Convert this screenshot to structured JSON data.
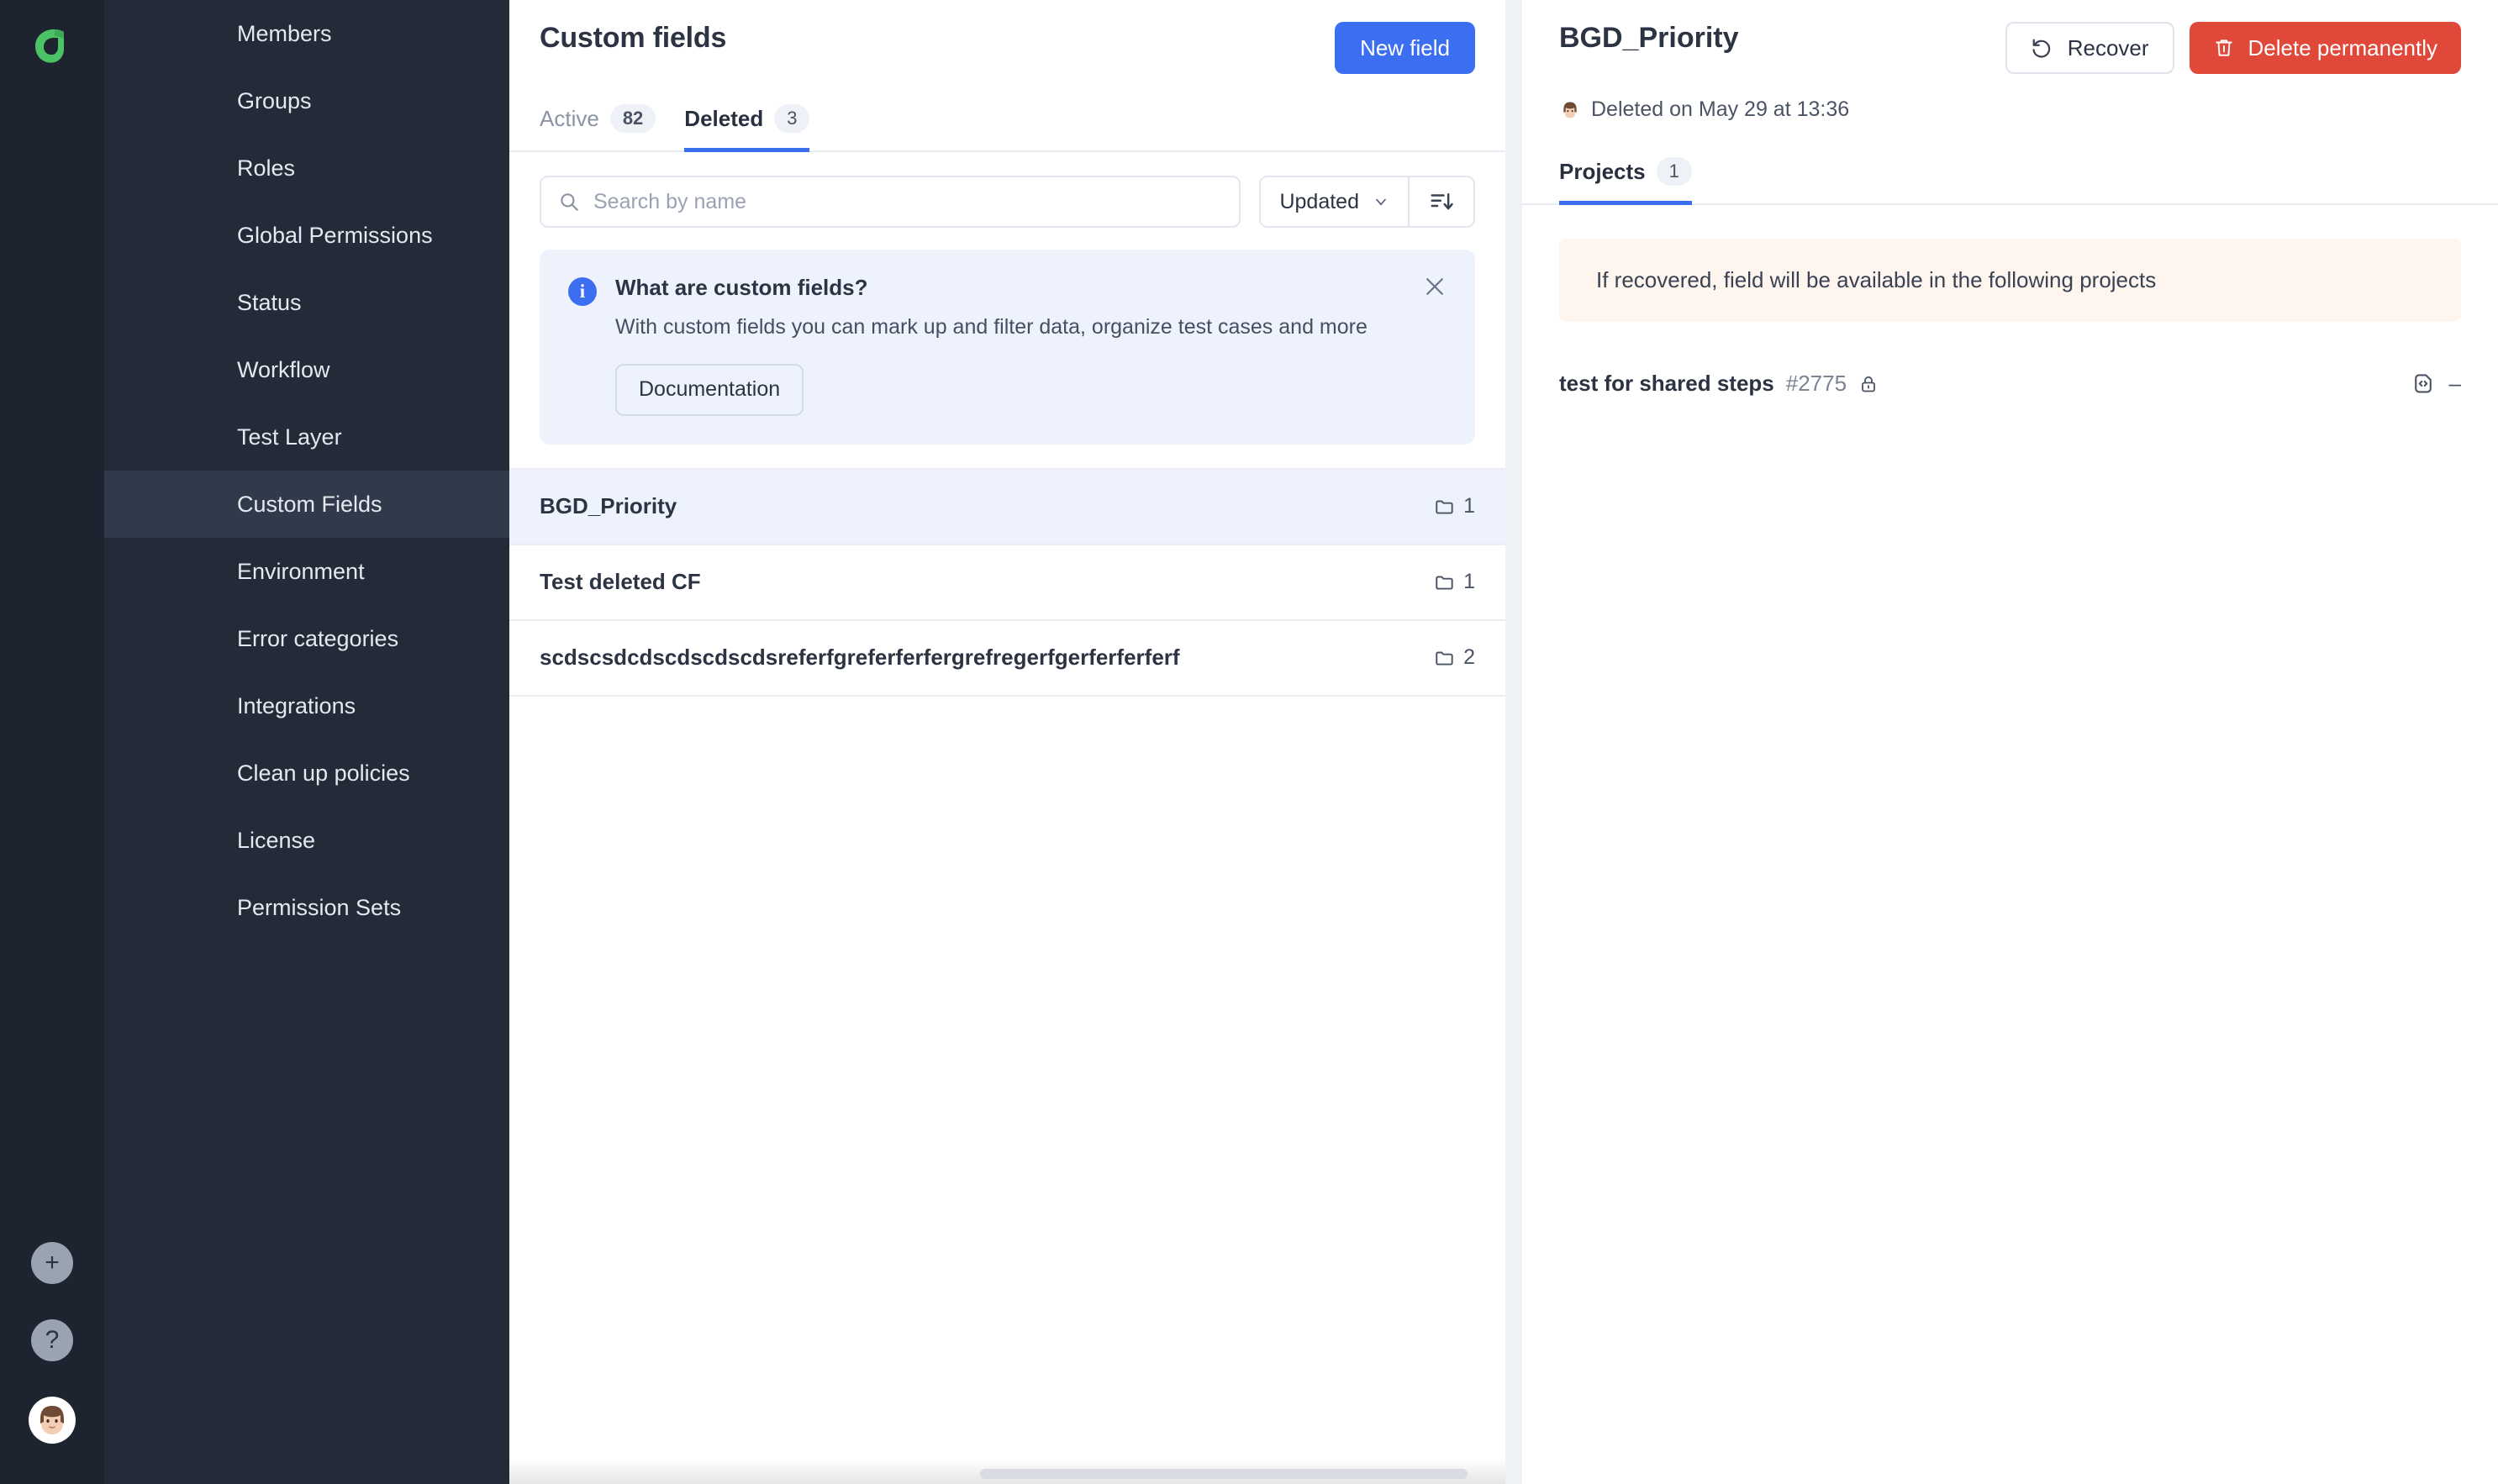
{
  "brand": {
    "logo_alt": "app-logo",
    "logo_color": "#4cc266"
  },
  "colors": {
    "accent_blue": "#3b6ef0",
    "danger_red": "#e0483a",
    "sidebar_bg": "#232b39",
    "rail_bg": "#1d2430",
    "selected_row": "#edf2fd",
    "banner_bg": "#eef2fd",
    "note_bg": "#fdf5ee"
  },
  "sidebar": {
    "items": [
      {
        "label": "Members",
        "active": false
      },
      {
        "label": "Groups",
        "active": false
      },
      {
        "label": "Roles",
        "active": false
      },
      {
        "label": "Global Permissions",
        "active": false
      },
      {
        "label": "Status",
        "active": false
      },
      {
        "label": "Workflow",
        "active": false
      },
      {
        "label": "Test Layer",
        "active": false
      },
      {
        "label": "Custom Fields",
        "active": true
      },
      {
        "label": "Environment",
        "active": false
      },
      {
        "label": "Error categories",
        "active": false
      },
      {
        "label": "Integrations",
        "active": false
      },
      {
        "label": "Clean up policies",
        "active": false
      },
      {
        "label": "License",
        "active": false
      },
      {
        "label": "Permission Sets",
        "active": false
      }
    ]
  },
  "rail": {
    "add_label": "+",
    "help_label": "?",
    "avatar_glyph": "👩"
  },
  "main": {
    "title": "Custom fields",
    "new_field_label": "New field",
    "tabs": [
      {
        "label": "Active",
        "count": "82",
        "active": false
      },
      {
        "label": "Deleted",
        "count": "3",
        "active": true
      }
    ],
    "search": {
      "placeholder": "Search by name",
      "value": ""
    },
    "sort": {
      "selected": "Updated",
      "direction_icon": "sort-desc-icon"
    },
    "banner": {
      "title": "What are custom fields?",
      "text": "With custom fields you can mark up and filter data, organize test cases and more",
      "button_label": "Documentation"
    },
    "rows": [
      {
        "name": "BGD_Priority",
        "count": "1",
        "selected": true
      },
      {
        "name": "Test deleted CF",
        "count": "1",
        "selected": false
      },
      {
        "name": "scdscsdcdscdscdscdsreferfgreferferfergrefregerfgerferferferf",
        "count": "2",
        "selected": false
      }
    ]
  },
  "detail": {
    "title": "BGD_Priority",
    "recover_label": "Recover",
    "delete_label": "Delete permanently",
    "deleted_meta": "Deleted on May 29 at 13:36",
    "tabs": [
      {
        "label": "Projects",
        "count": "1",
        "active": true
      }
    ],
    "note": "If recovered, field will be available in the following projects",
    "projects": [
      {
        "name": "test for shared steps",
        "id": "#2775",
        "lock": true,
        "value": "–"
      }
    ]
  }
}
